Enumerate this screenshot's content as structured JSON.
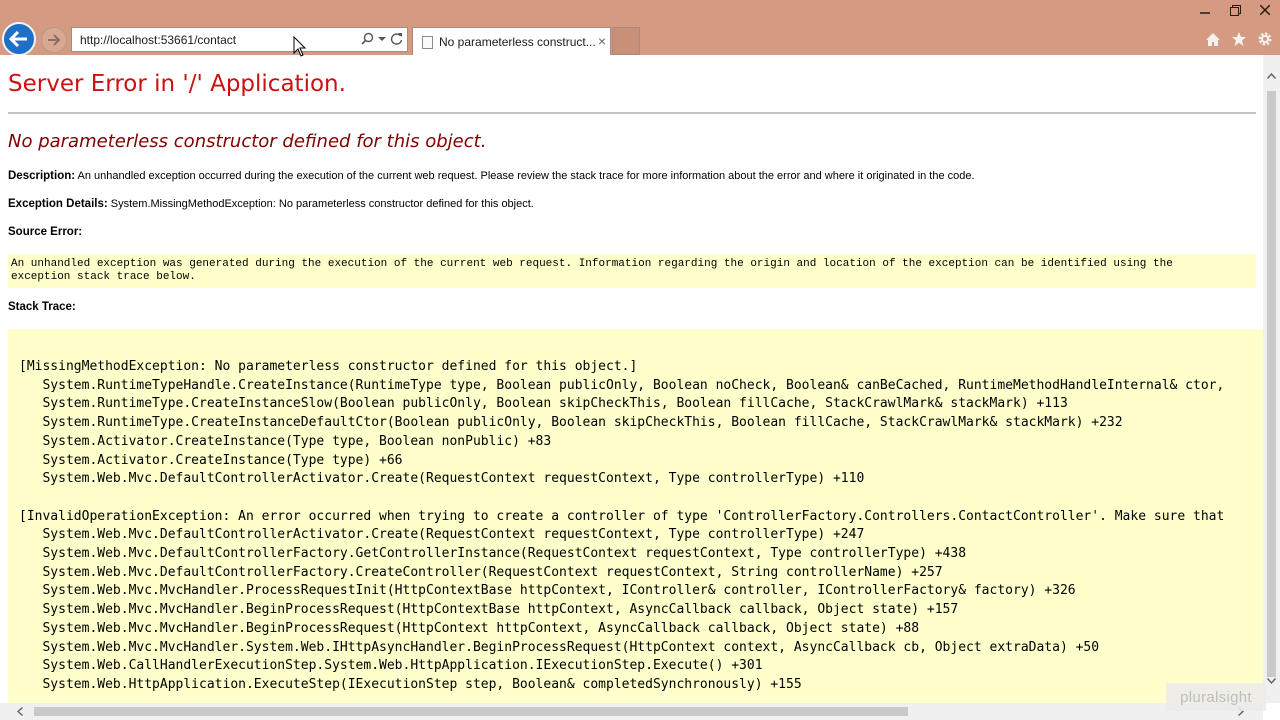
{
  "browser": {
    "address_url": "http://localhost:53661/contact",
    "tab_title": "No parameterless construct...",
    "tab_close": "×",
    "window_controls": [
      "minimize-icon",
      "restore-icon",
      "close-icon"
    ],
    "toolbar_icons": [
      "home-icon",
      "favorites-star-icon",
      "settings-gear-icon"
    ]
  },
  "page": {
    "server_error_title": "Server Error in '/' Application.",
    "error_message": "No parameterless constructor defined for this object.",
    "description_label": "Description:",
    "description_text": "An unhandled exception occurred during the execution of the current web request. Please review the stack trace for more information about the error and where it originated in the code.",
    "exception_label": "Exception Details:",
    "exception_text": "System.MissingMethodException: No parameterless constructor defined for this object.",
    "source_error_label": "Source Error:",
    "source_error_lines": [
      "An unhandled exception was generated during the execution of the current web request. Information regarding the origin and location of the exception can be identified using the",
      "exception stack trace below."
    ],
    "stack_trace_label": "Stack Trace:",
    "stack_trace_lines": [
      "[MissingMethodException: No parameterless constructor defined for this object.]",
      "   System.RuntimeTypeHandle.CreateInstance(RuntimeType type, Boolean publicOnly, Boolean noCheck, Boolean& canBeCached, RuntimeMethodHandleInternal& ctor,",
      "   System.RuntimeType.CreateInstanceSlow(Boolean publicOnly, Boolean skipCheckThis, Boolean fillCache, StackCrawlMark& stackMark) +113",
      "   System.RuntimeType.CreateInstanceDefaultCtor(Boolean publicOnly, Boolean skipCheckThis, Boolean fillCache, StackCrawlMark& stackMark) +232",
      "   System.Activator.CreateInstance(Type type, Boolean nonPublic) +83",
      "   System.Activator.CreateInstance(Type type) +66",
      "   System.Web.Mvc.DefaultControllerActivator.Create(RequestContext requestContext, Type controllerType) +110",
      "",
      "[InvalidOperationException: An error occurred when trying to create a controller of type 'ControllerFactory.Controllers.ContactController'. Make sure that",
      "   System.Web.Mvc.DefaultControllerActivator.Create(RequestContext requestContext, Type controllerType) +247",
      "   System.Web.Mvc.DefaultControllerFactory.GetControllerInstance(RequestContext requestContext, Type controllerType) +438",
      "   System.Web.Mvc.DefaultControllerFactory.CreateController(RequestContext requestContext, String controllerName) +257",
      "   System.Web.Mvc.MvcHandler.ProcessRequestInit(HttpContextBase httpContext, IController& controller, IControllerFactory& factory) +326",
      "   System.Web.Mvc.MvcHandler.BeginProcessRequest(HttpContextBase httpContext, AsyncCallback callback, Object state) +157",
      "   System.Web.Mvc.MvcHandler.BeginProcessRequest(HttpContext httpContext, AsyncCallback callback, Object state) +88",
      "   System.Web.Mvc.MvcHandler.System.Web.IHttpAsyncHandler.BeginProcessRequest(HttpContext context, AsyncCallback cb, Object extraData) +50",
      "   System.Web.CallHandlerExecutionStep.System.Web.HttpApplication.IExecutionStep.Execute() +301",
      "   System.Web.HttpApplication.ExecuteStep(IExecutionStep step, Boolean& completedSynchronously) +155"
    ]
  },
  "watermark": "pluralsight",
  "colors": {
    "chrome_bg": "#d49b82",
    "error_title": "#cc1111",
    "error_message": "#800000",
    "code_bg": "#ffffcc",
    "back_button": "#1e6fc6"
  }
}
